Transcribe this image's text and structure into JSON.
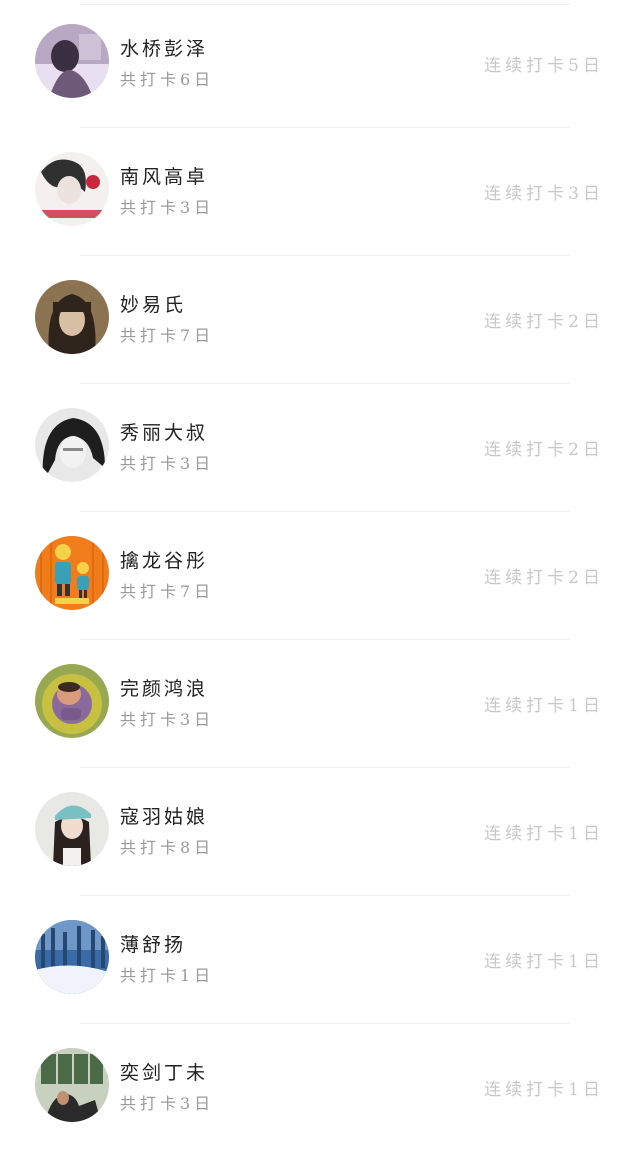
{
  "users": [
    {
      "name": "水桥彭泽",
      "total": "共打卡6日",
      "streak": "连续打卡5日",
      "avatar": "avatar-1",
      "avatar_colors": [
        "#6e5a78",
        "#b9a8c4",
        "#e8dff0"
      ]
    },
    {
      "name": "南风高卓",
      "total": "共打卡3日",
      "streak": "连续打卡3日",
      "avatar": "avatar-2",
      "avatar_colors": [
        "#303030",
        "#f4f0f0",
        "#c8283c"
      ]
    },
    {
      "name": "妙易氏",
      "total": "共打卡7日",
      "streak": "连续打卡2日",
      "avatar": "avatar-3",
      "avatar_colors": [
        "#8b7250",
        "#2f241c",
        "#d8c0a4"
      ]
    },
    {
      "name": "秀丽大叔",
      "total": "共打卡3日",
      "streak": "连续打卡2日",
      "avatar": "avatar-4",
      "avatar_colors": [
        "#1e1e1e",
        "#e8e8e8",
        "#8a8a8a"
      ]
    },
    {
      "name": "擒龙谷彤",
      "total": "共打卡7日",
      "streak": "连续打卡2日",
      "avatar": "avatar-5",
      "avatar_colors": [
        "#f07c1c",
        "#3aa0b8",
        "#f6d24a"
      ]
    },
    {
      "name": "完颜鸿浪",
      "total": "共打卡3日",
      "streak": "连续打卡1日",
      "avatar": "avatar-6",
      "avatar_colors": [
        "#c8c040",
        "#7a5a8c",
        "#d89c7c"
      ]
    },
    {
      "name": "寇羽姑娘",
      "total": "共打卡8日",
      "streak": "连续打卡1日",
      "avatar": "avatar-7",
      "avatar_colors": [
        "#e8e8e4",
        "#2b2220",
        "#78c0c4"
      ]
    },
    {
      "name": "薄舒扬",
      "total": "共打卡1日",
      "streak": "连续打卡1日",
      "avatar": "avatar-8",
      "avatar_colors": [
        "#3a6aa8",
        "#f0f4fa",
        "#244870"
      ]
    },
    {
      "name": "奕剑丁未",
      "total": "共打卡3日",
      "streak": "连续打卡1日",
      "avatar": "avatar-9",
      "avatar_colors": [
        "#4a6a48",
        "#c8d0c0",
        "#2a2a2a"
      ]
    }
  ]
}
